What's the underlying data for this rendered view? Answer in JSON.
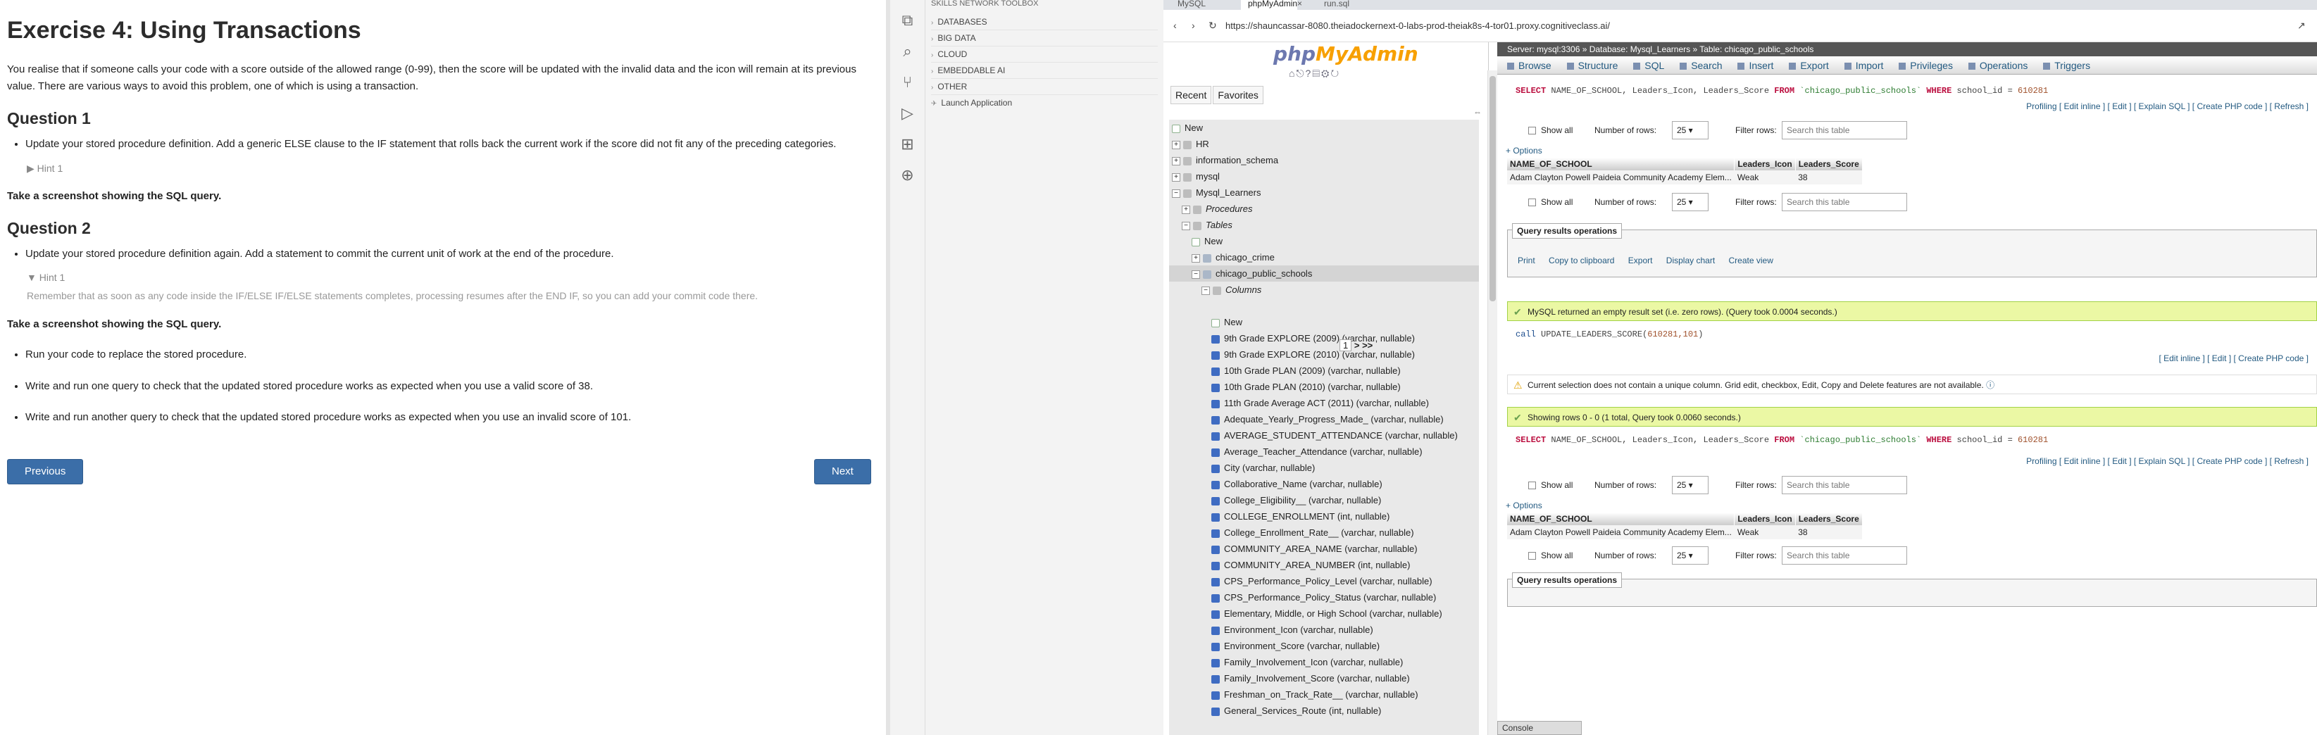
{
  "exercise": {
    "title": "Exercise 4: Using Transactions",
    "intro": "You realise that if someone calls your code with a score outside of the allowed range (0-99), then the score will be updated with the invalid data and the icon will remain at its previous value. There are various ways to avoid this problem, one of which is using a transaction.",
    "q1_title": "Question 1",
    "q1_item": "Update your stored procedure definition. Add a generic ELSE clause to the IF statement that rolls back the current work if the score did not fit any of the preceding categories.",
    "q1_hint": "▶ Hint 1",
    "q1_screenshot": "Take a screenshot showing the SQL query.",
    "q2_title": "Question 2",
    "q2_item": "Update your stored procedure definition again. Add a statement to commit the current unit of work at the end of the procedure.",
    "q2_hint": "▼ Hint 1",
    "q2_hint_body": "Remember that as soon as any code inside the IF/ELSE IF/ELSE statements completes, processing resumes after the END IF, so you can add your commit code there.",
    "q2_screenshot": "Take a screenshot showing the SQL query.",
    "steps": [
      "Run your code to replace the stored procedure.",
      "Write and run one query to check that the updated stored procedure works as expected when you use a valid score of 38.",
      "Write and run another query to check that the updated stored procedure works as expected when you use an invalid score of 101."
    ],
    "prev_label": "Previous",
    "next_label": "Next"
  },
  "toolbox": {
    "header": "SKILLS NETWORK TOOLBOX",
    "items": [
      "DATABASES",
      "BIG DATA",
      "CLOUD",
      "EMBEDDABLE AI",
      "OTHER"
    ],
    "launch": "Launch Application"
  },
  "browser": {
    "tabs": [
      "MySQL",
      "phpMyAdmin",
      "run.sql"
    ],
    "close": "×",
    "url": "https://shauncassar-8080.theiadockernext-0-labs-prod-theiak8s-4-tor01.proxy.cognitiveclass.ai/"
  },
  "pma_nav": {
    "logo_php": "php",
    "logo_admin": "MyAdmin",
    "recent": "Recent",
    "favorites": "Favorites",
    "tree": [
      {
        "label": "New",
        "indent": 0,
        "kind": "new"
      },
      {
        "label": "HR",
        "indent": 0,
        "kind": "db",
        "exp": "+"
      },
      {
        "label": "information_schema",
        "indent": 0,
        "kind": "db",
        "exp": "+"
      },
      {
        "label": "mysql",
        "indent": 0,
        "kind": "db",
        "exp": "+"
      },
      {
        "label": "Mysql_Learners",
        "indent": 0,
        "kind": "db",
        "exp": "−"
      },
      {
        "label": "Procedures",
        "indent": 1,
        "kind": "db",
        "exp": "+",
        "italic": true
      },
      {
        "label": "Tables",
        "indent": 1,
        "kind": "db",
        "exp": "−",
        "italic": true
      },
      {
        "label": "New",
        "indent": 2,
        "kind": "new"
      },
      {
        "label": "chicago_crime",
        "indent": 2,
        "kind": "tbl",
        "exp": "+"
      },
      {
        "label": "chicago_public_schools",
        "indent": 2,
        "kind": "tbl",
        "exp": "−",
        "selected": true
      },
      {
        "label": "Columns",
        "indent": 3,
        "kind": "db",
        "exp": "−",
        "italic": true
      },
      {
        "label": "",
        "indent": 0,
        "kind": "blank"
      },
      {
        "label": "New",
        "indent": 4,
        "kind": "new"
      },
      {
        "label": "9th Grade EXPLORE (2009) (varchar, nullable)",
        "indent": 4,
        "kind": "col"
      },
      {
        "label": "9th Grade EXPLORE (2010) (varchar, nullable)",
        "indent": 4,
        "kind": "col"
      },
      {
        "label": "10th Grade PLAN (2009) (varchar, nullable)",
        "indent": 4,
        "kind": "col"
      },
      {
        "label": "10th Grade PLAN (2010) (varchar, nullable)",
        "indent": 4,
        "kind": "col"
      },
      {
        "label": "11th Grade Average ACT (2011) (varchar, nullable)",
        "indent": 4,
        "kind": "col"
      },
      {
        "label": "Adequate_Yearly_Progress_Made_ (varchar, nullable)",
        "indent": 4,
        "kind": "col"
      },
      {
        "label": "AVERAGE_STUDENT_ATTENDANCE (varchar, nullable)",
        "indent": 4,
        "kind": "col"
      },
      {
        "label": "Average_Teacher_Attendance (varchar, nullable)",
        "indent": 4,
        "kind": "col"
      },
      {
        "label": "City (varchar, nullable)",
        "indent": 4,
        "kind": "col"
      },
      {
        "label": "Collaborative_Name (varchar, nullable)",
        "indent": 4,
        "kind": "col"
      },
      {
        "label": "College_Eligibility__ (varchar, nullable)",
        "indent": 4,
        "kind": "col"
      },
      {
        "label": "COLLEGE_ENROLLMENT (int, nullable)",
        "indent": 4,
        "kind": "col"
      },
      {
        "label": "College_Enrollment_Rate__ (varchar, nullable)",
        "indent": 4,
        "kind": "col"
      },
      {
        "label": "COMMUNITY_AREA_NAME (varchar, nullable)",
        "indent": 4,
        "kind": "col"
      },
      {
        "label": "COMMUNITY_AREA_NUMBER (int, nullable)",
        "indent": 4,
        "kind": "col"
      },
      {
        "label": "CPS_Performance_Policy_Level (varchar, nullable)",
        "indent": 4,
        "kind": "col"
      },
      {
        "label": "CPS_Performance_Policy_Status (varchar, nullable)",
        "indent": 4,
        "kind": "col"
      },
      {
        "label": "Elementary, Middle, or High School (varchar, nullable)",
        "indent": 4,
        "kind": "col"
      },
      {
        "label": "Environment_Icon (varchar, nullable)",
        "indent": 4,
        "kind": "col"
      },
      {
        "label": "Environment_Score (varchar, nullable)",
        "indent": 4,
        "kind": "col"
      },
      {
        "label": "Family_Involvement_Icon (varchar, nullable)",
        "indent": 4,
        "kind": "col"
      },
      {
        "label": "Family_Involvement_Score (varchar, nullable)",
        "indent": 4,
        "kind": "col"
      },
      {
        "label": "Freshman_on_Track_Rate__ (varchar, nullable)",
        "indent": 4,
        "kind": "col"
      },
      {
        "label": "General_Services_Route (int, nullable)",
        "indent": 4,
        "kind": "col"
      }
    ],
    "pager_value": "1",
    "pager_next": "> >>"
  },
  "pma_main": {
    "breadcrumb": "Server: mysql:3306 » Database: Mysql_Learners » Table: chicago_public_schools",
    "menu": [
      "Browse",
      "Structure",
      "SQL",
      "Search",
      "Insert",
      "Export",
      "Import",
      "Privileges",
      "Operations",
      "Triggers"
    ],
    "sql_select": {
      "kw1": "SELECT",
      "cols": " NAME_OF_SCHOOL, Leaders_Icon, Leaders_Score ",
      "kw2": "FROM",
      "table": " `chicago_public_schools` ",
      "kw3": "WHERE",
      "cond": " school_id ",
      "eq": "= ",
      "val": "610281"
    },
    "sql_call": {
      "kw": "call",
      "proc": " UPDATE_LEADERS_SCORE(",
      "args": "610281,101",
      "close": ")"
    },
    "links_full": "Profiling [ Edit inline ] [ Edit ] [ Explain SQL ] [ Create PHP code ] [ Refresh ]",
    "links_short": "[ Edit inline ] [ Edit ] [ Create PHP code ]",
    "show_all": "Show all",
    "num_rows_label": "Number of rows:",
    "num_rows_value": "25 ▾",
    "filter_label": "Filter rows:",
    "filter_placeholder": "Search this table",
    "options": "+ Options",
    "columns": [
      "NAME_OF_SCHOOL",
      "Leaders_Icon",
      "Leaders_Score"
    ],
    "row": [
      "Adam Clayton Powell Paideia Community Academy Elem...",
      "Weak",
      "38"
    ],
    "qro_legend": "Query results operations",
    "qro_ops": [
      "Print",
      "Copy to clipboard",
      "Export",
      "Display chart",
      "Create view"
    ],
    "msg_empty": "MySQL returned an empty result set (i.e. zero rows). (Query took 0.0004 seconds.)",
    "msg_warn": "Current selection does not contain a unique column. Grid edit, checkbox, Edit, Copy and Delete features are not available.",
    "msg_rows": "Showing rows 0 - 0 (1 total, Query took 0.0060 seconds.)",
    "console": "Console"
  },
  "colors": {
    "accent": "#3b6ea8",
    "success_bg": "#ebf8a4",
    "link": "#235a81",
    "sql_keyword": "#bb0e3f"
  }
}
